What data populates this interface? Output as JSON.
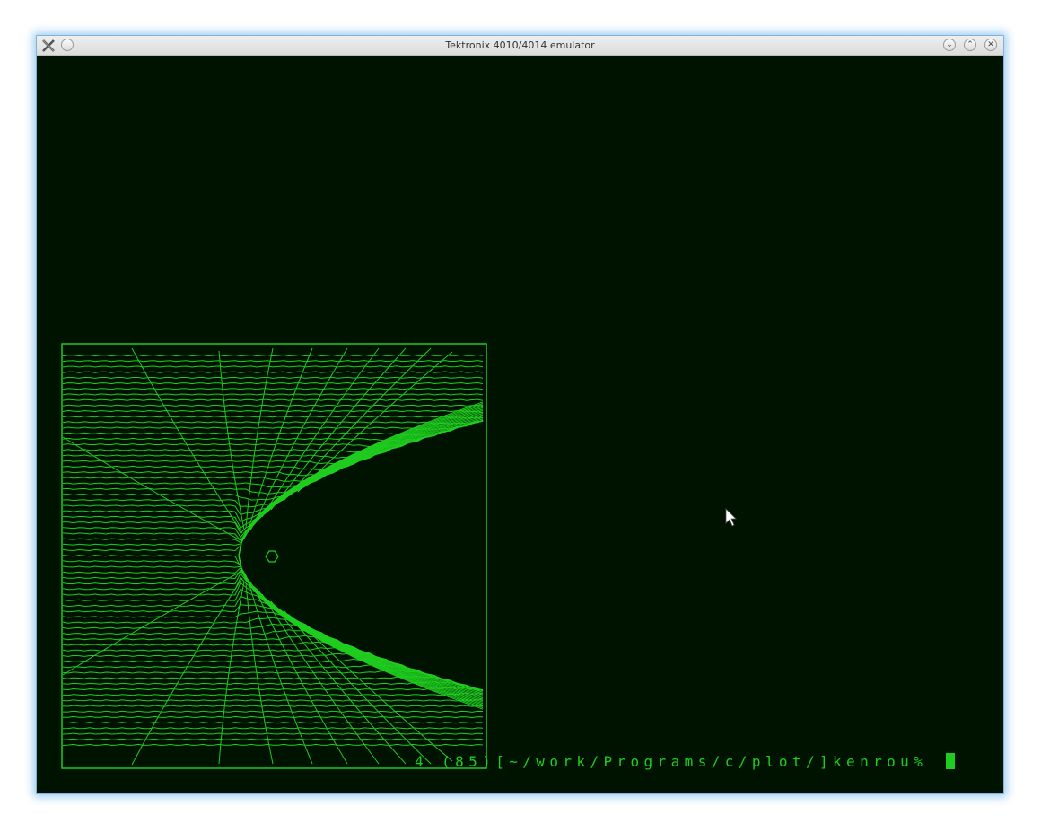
{
  "window": {
    "title": "Tektronix 4010/4014 emulator",
    "buttons": {
      "menu": "",
      "minimize": "⌄",
      "maximize": "⌃",
      "close": "✕"
    }
  },
  "terminal": {
    "background": "#001200",
    "phosphor_color": "#1fcd1f",
    "prompt": "4 (85)[~/work/Programs/c/plot/]kenrou% "
  },
  "icons": {
    "app": "x-window-icon",
    "pointer": "mouse-pointer-icon"
  }
}
